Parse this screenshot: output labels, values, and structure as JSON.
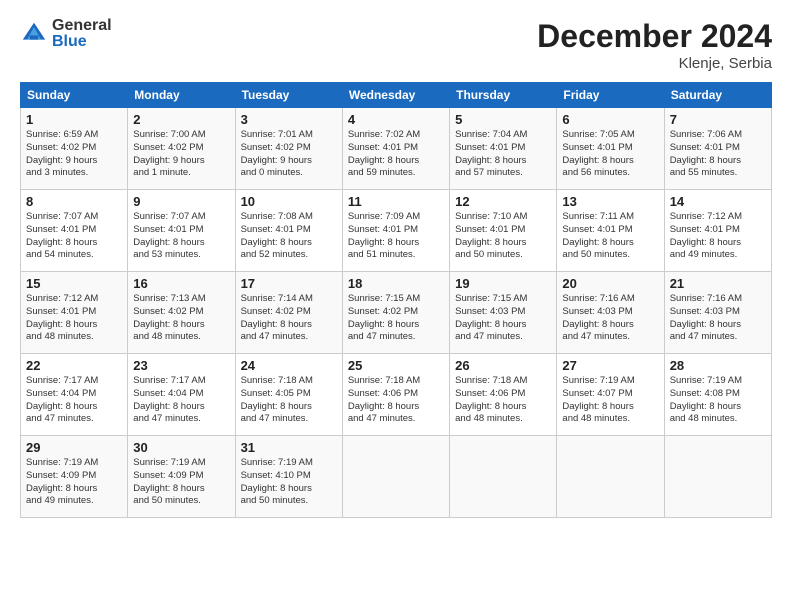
{
  "header": {
    "logo_general": "General",
    "logo_blue": "Blue",
    "month_title": "December 2024",
    "location": "Klenje, Serbia"
  },
  "days_of_week": [
    "Sunday",
    "Monday",
    "Tuesday",
    "Wednesday",
    "Thursday",
    "Friday",
    "Saturday"
  ],
  "weeks": [
    [
      {
        "day": "1",
        "info": "Sunrise: 6:59 AM\nSunset: 4:02 PM\nDaylight: 9 hours\nand 3 minutes."
      },
      {
        "day": "2",
        "info": "Sunrise: 7:00 AM\nSunset: 4:02 PM\nDaylight: 9 hours\nand 1 minute."
      },
      {
        "day": "3",
        "info": "Sunrise: 7:01 AM\nSunset: 4:02 PM\nDaylight: 9 hours\nand 0 minutes."
      },
      {
        "day": "4",
        "info": "Sunrise: 7:02 AM\nSunset: 4:01 PM\nDaylight: 8 hours\nand 59 minutes."
      },
      {
        "day": "5",
        "info": "Sunrise: 7:04 AM\nSunset: 4:01 PM\nDaylight: 8 hours\nand 57 minutes."
      },
      {
        "day": "6",
        "info": "Sunrise: 7:05 AM\nSunset: 4:01 PM\nDaylight: 8 hours\nand 56 minutes."
      },
      {
        "day": "7",
        "info": "Sunrise: 7:06 AM\nSunset: 4:01 PM\nDaylight: 8 hours\nand 55 minutes."
      }
    ],
    [
      {
        "day": "8",
        "info": "Sunrise: 7:07 AM\nSunset: 4:01 PM\nDaylight: 8 hours\nand 54 minutes."
      },
      {
        "day": "9",
        "info": "Sunrise: 7:07 AM\nSunset: 4:01 PM\nDaylight: 8 hours\nand 53 minutes."
      },
      {
        "day": "10",
        "info": "Sunrise: 7:08 AM\nSunset: 4:01 PM\nDaylight: 8 hours\nand 52 minutes."
      },
      {
        "day": "11",
        "info": "Sunrise: 7:09 AM\nSunset: 4:01 PM\nDaylight: 8 hours\nand 51 minutes."
      },
      {
        "day": "12",
        "info": "Sunrise: 7:10 AM\nSunset: 4:01 PM\nDaylight: 8 hours\nand 50 minutes."
      },
      {
        "day": "13",
        "info": "Sunrise: 7:11 AM\nSunset: 4:01 PM\nDaylight: 8 hours\nand 50 minutes."
      },
      {
        "day": "14",
        "info": "Sunrise: 7:12 AM\nSunset: 4:01 PM\nDaylight: 8 hours\nand 49 minutes."
      }
    ],
    [
      {
        "day": "15",
        "info": "Sunrise: 7:12 AM\nSunset: 4:01 PM\nDaylight: 8 hours\nand 48 minutes."
      },
      {
        "day": "16",
        "info": "Sunrise: 7:13 AM\nSunset: 4:02 PM\nDaylight: 8 hours\nand 48 minutes."
      },
      {
        "day": "17",
        "info": "Sunrise: 7:14 AM\nSunset: 4:02 PM\nDaylight: 8 hours\nand 47 minutes."
      },
      {
        "day": "18",
        "info": "Sunrise: 7:15 AM\nSunset: 4:02 PM\nDaylight: 8 hours\nand 47 minutes."
      },
      {
        "day": "19",
        "info": "Sunrise: 7:15 AM\nSunset: 4:03 PM\nDaylight: 8 hours\nand 47 minutes."
      },
      {
        "day": "20",
        "info": "Sunrise: 7:16 AM\nSunset: 4:03 PM\nDaylight: 8 hours\nand 47 minutes."
      },
      {
        "day": "21",
        "info": "Sunrise: 7:16 AM\nSunset: 4:03 PM\nDaylight: 8 hours\nand 47 minutes."
      }
    ],
    [
      {
        "day": "22",
        "info": "Sunrise: 7:17 AM\nSunset: 4:04 PM\nDaylight: 8 hours\nand 47 minutes."
      },
      {
        "day": "23",
        "info": "Sunrise: 7:17 AM\nSunset: 4:04 PM\nDaylight: 8 hours\nand 47 minutes."
      },
      {
        "day": "24",
        "info": "Sunrise: 7:18 AM\nSunset: 4:05 PM\nDaylight: 8 hours\nand 47 minutes."
      },
      {
        "day": "25",
        "info": "Sunrise: 7:18 AM\nSunset: 4:06 PM\nDaylight: 8 hours\nand 47 minutes."
      },
      {
        "day": "26",
        "info": "Sunrise: 7:18 AM\nSunset: 4:06 PM\nDaylight: 8 hours\nand 48 minutes."
      },
      {
        "day": "27",
        "info": "Sunrise: 7:19 AM\nSunset: 4:07 PM\nDaylight: 8 hours\nand 48 minutes."
      },
      {
        "day": "28",
        "info": "Sunrise: 7:19 AM\nSunset: 4:08 PM\nDaylight: 8 hours\nand 48 minutes."
      }
    ],
    [
      {
        "day": "29",
        "info": "Sunrise: 7:19 AM\nSunset: 4:09 PM\nDaylight: 8 hours\nand 49 minutes."
      },
      {
        "day": "30",
        "info": "Sunrise: 7:19 AM\nSunset: 4:09 PM\nDaylight: 8 hours\nand 50 minutes."
      },
      {
        "day": "31",
        "info": "Sunrise: 7:19 AM\nSunset: 4:10 PM\nDaylight: 8 hours\nand 50 minutes."
      },
      {
        "day": "",
        "info": ""
      },
      {
        "day": "",
        "info": ""
      },
      {
        "day": "",
        "info": ""
      },
      {
        "day": "",
        "info": ""
      }
    ]
  ]
}
